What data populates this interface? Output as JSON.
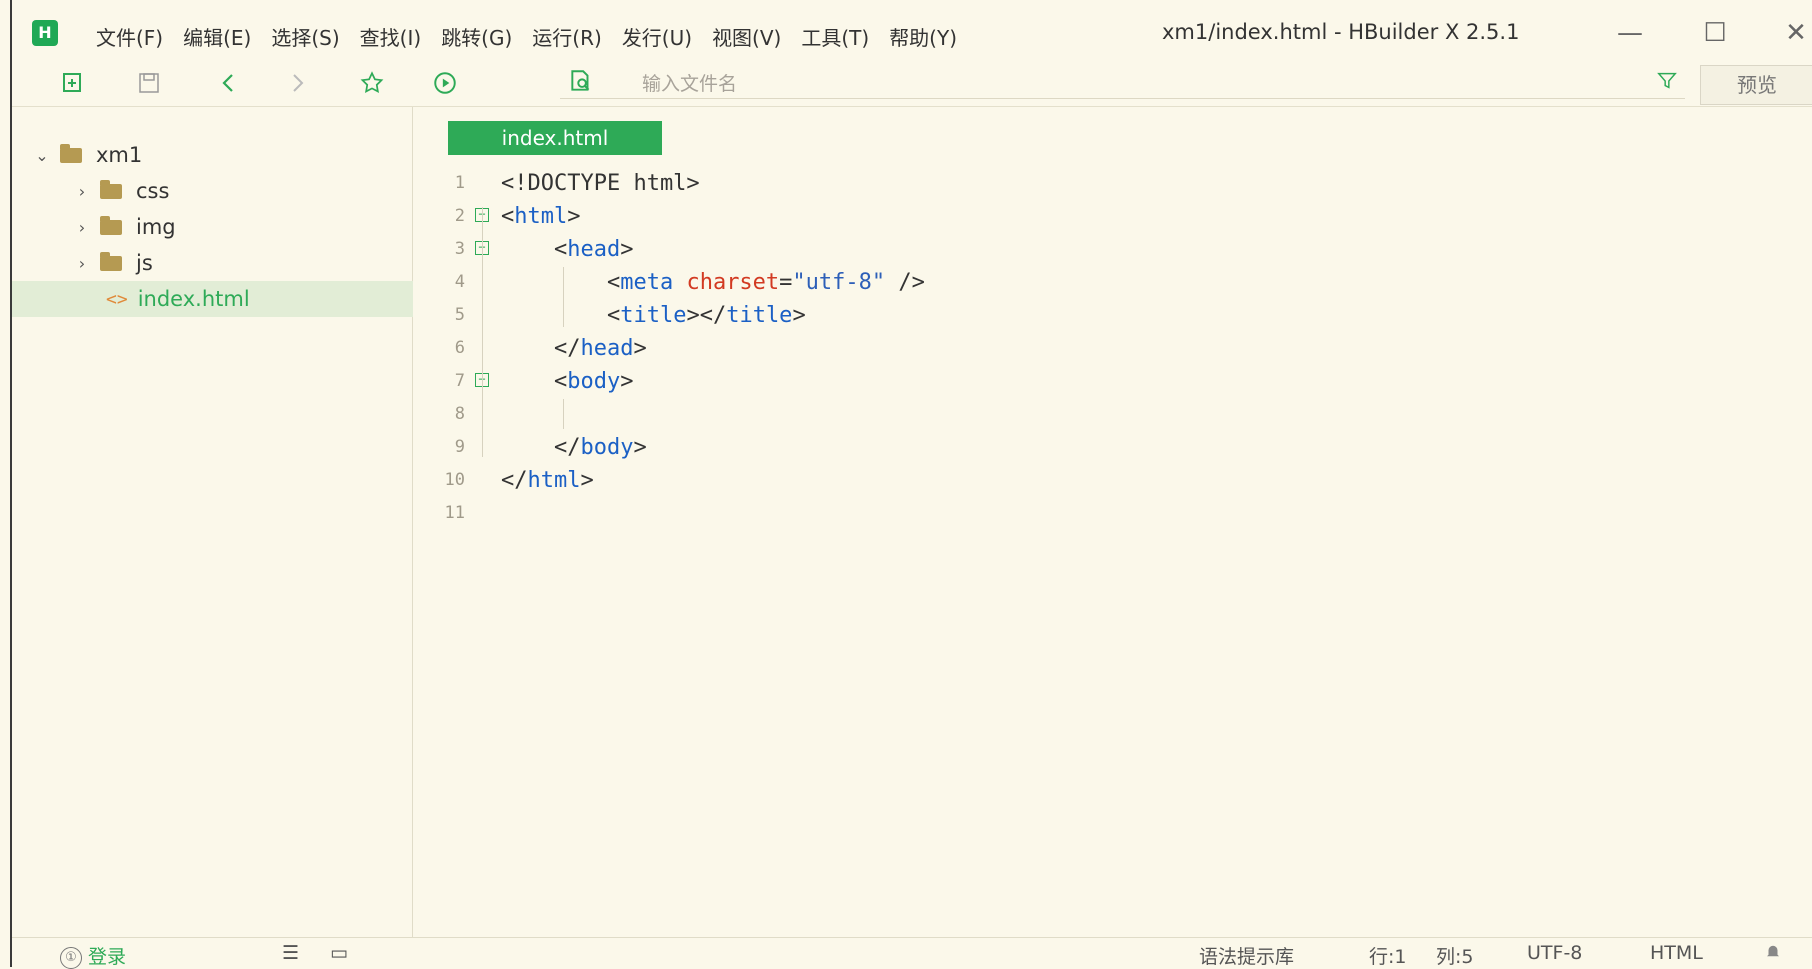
{
  "app": {
    "window_title": "xm1/index.html - HBuilder X 2.5.1",
    "logo_letter": "H",
    "brand_color": "#1fa855"
  },
  "menu": [
    "文件(F)",
    "编辑(E)",
    "选择(S)",
    "查找(I)",
    "跳转(G)",
    "运行(R)",
    "发行(U)",
    "视图(V)",
    "工具(T)",
    "帮助(Y)"
  ],
  "window_controls": {
    "minimize": "—",
    "maximize": "☐",
    "close": "✕"
  },
  "toolbar": {
    "icons": [
      "new-file-icon",
      "save-icon",
      "back-icon",
      "forward-icon",
      "favorite-icon",
      "run-icon",
      "file-search-icon",
      "filter-icon"
    ],
    "search_placeholder": "输入文件名",
    "preview_label": "预览"
  },
  "sidebar": {
    "project": "xm1",
    "items": [
      {
        "label": "css",
        "type": "folder"
      },
      {
        "label": "img",
        "type": "folder"
      },
      {
        "label": "js",
        "type": "folder"
      },
      {
        "label": "index.html",
        "type": "file",
        "selected": true,
        "icon_text": "<>"
      }
    ]
  },
  "editor": {
    "tab_label": "index.html",
    "lines": [
      {
        "n": "1",
        "tokens": [
          [
            "plain",
            "<!DOCTYPE html>"
          ]
        ]
      },
      {
        "n": "2",
        "fold": "⊟",
        "tokens": [
          [
            "plain",
            "<"
          ],
          [
            "tag",
            "html"
          ],
          [
            "plain",
            ">"
          ]
        ]
      },
      {
        "n": "3",
        "fold": "⊟",
        "tokens": [
          [
            "plain",
            "    <"
          ],
          [
            "tag",
            "head"
          ],
          [
            "plain",
            ">"
          ]
        ]
      },
      {
        "n": "4",
        "tokens": [
          [
            "plain",
            "        <"
          ],
          [
            "tag",
            "meta"
          ],
          [
            "plain",
            " "
          ],
          [
            "attr",
            "charset"
          ],
          [
            "plain",
            "="
          ],
          [
            "str",
            "\"utf-8\""
          ],
          [
            "plain",
            " />"
          ]
        ]
      },
      {
        "n": "5",
        "tokens": [
          [
            "plain",
            "        <"
          ],
          [
            "tag",
            "title"
          ],
          [
            "plain",
            "></"
          ],
          [
            "tag",
            "title"
          ],
          [
            "plain",
            ">"
          ]
        ]
      },
      {
        "n": "6",
        "tokens": [
          [
            "plain",
            "    </"
          ],
          [
            "tag",
            "head"
          ],
          [
            "plain",
            ">"
          ]
        ]
      },
      {
        "n": "7",
        "fold": "⊟",
        "tokens": [
          [
            "plain",
            "    <"
          ],
          [
            "tag",
            "body"
          ],
          [
            "plain",
            ">"
          ]
        ]
      },
      {
        "n": "8",
        "tokens": []
      },
      {
        "n": "9",
        "tokens": [
          [
            "plain",
            "    </"
          ],
          [
            "tag",
            "body"
          ],
          [
            "plain",
            ">"
          ]
        ]
      },
      {
        "n": "10",
        "tokens": [
          [
            "plain",
            "</"
          ],
          [
            "tag",
            "html"
          ],
          [
            "plain",
            ">"
          ]
        ]
      },
      {
        "n": "11",
        "tokens": []
      }
    ]
  },
  "statusbar": {
    "login_label": "登录",
    "syntax_lib": "语法提示库",
    "row": "行:1",
    "col": "列:5",
    "encoding": "UTF-8",
    "language": "HTML"
  }
}
